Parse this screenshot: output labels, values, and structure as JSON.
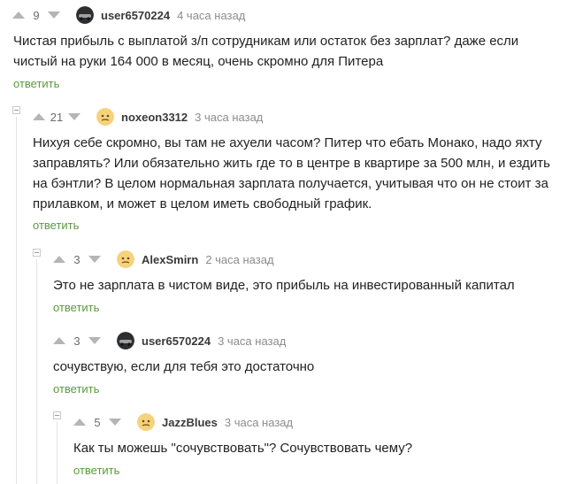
{
  "comments": [
    {
      "votes": "9",
      "user": "user6570224",
      "time": "4 часа назад",
      "text": "Чистая прибыль с выплатой з/п сотрудникам или остаток без зарплат? даже если чистый на руки 164 000 в месяц, очень скромно для Питера",
      "reply": "ответить",
      "avatar": "dark-car-avatar"
    },
    {
      "votes": "21",
      "user": "noxeon3312",
      "time": "3 часа назад",
      "text": "Нихуя себе скромно, вы там не ахуели часом? Питер что ебать Монако, надо яхту заправлять? Или обязательно жить где то в центре в квартире за 500 млн, и ездить на бэнтли? В целом нормальная зарплата получается, учитывая что он не стоит за прилавком, и может в целом иметь свободный график.",
      "reply": "ответить",
      "avatar": "default-face-avatar"
    },
    {
      "votes": "3",
      "user": "AlexSmirn",
      "time": "2 часа назад",
      "text": "Это не зарплата в чистом виде, это прибыль на инвестированный капитал",
      "reply": "ответить",
      "avatar": "default-face-avatar"
    },
    {
      "votes": "3",
      "user": "user6570224",
      "time": "3 часа назад",
      "text": "сочувствую, если для тебя это достаточно",
      "reply": "ответить",
      "avatar": "dark-car-avatar"
    },
    {
      "votes": "5",
      "user": "JazzBlues",
      "time": "3 часа назад",
      "text": "Как ты можешь \"сочувствовать\"? Сочувствовать чему?",
      "reply": "ответить",
      "avatar": "default-face-avatar"
    }
  ],
  "colors": {
    "reply_link": "#5b9a3b",
    "vote_arrow": "#b5b5b5",
    "username": "#3a3a3a",
    "timestamp": "#8c8c8c",
    "thread_line": "#e3e3e3"
  }
}
